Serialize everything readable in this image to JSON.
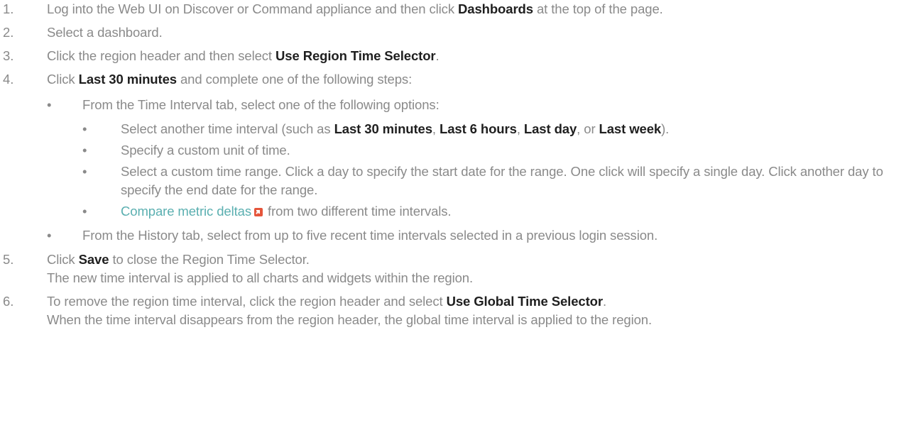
{
  "steps": [
    {
      "num": "1.",
      "parts": [
        {
          "t": "Log into the Web UI on Discover or Command appliance and then click "
        },
        {
          "t": "Dashboards",
          "b": true
        },
        {
          "t": " at the top of the page."
        }
      ]
    },
    {
      "num": "2.",
      "parts": [
        {
          "t": "Select a dashboard."
        }
      ]
    },
    {
      "num": "3.",
      "parts": [
        {
          "t": "Click the region header and then select "
        },
        {
          "t": "Use Region Time Selector",
          "b": true
        },
        {
          "t": "."
        }
      ]
    },
    {
      "num": "4.",
      "parts": [
        {
          "t": "Click "
        },
        {
          "t": "Last 30 minutes",
          "b": true
        },
        {
          "t": " and complete one of the following steps:"
        }
      ],
      "bullets": [
        {
          "parts": [
            {
              "t": "From the Time Interval tab, select one of the following options:"
            }
          ],
          "sub": [
            {
              "parts": [
                {
                  "t": "Select another time interval (such as "
                },
                {
                  "t": "Last 30 minutes",
                  "b": true
                },
                {
                  "t": ", "
                },
                {
                  "t": "Last 6 hours",
                  "b": true
                },
                {
                  "t": ", "
                },
                {
                  "t": "Last day",
                  "b": true
                },
                {
                  "t": ", or "
                },
                {
                  "t": "Last week",
                  "b": true
                },
                {
                  "t": ")."
                }
              ]
            },
            {
              "parts": [
                {
                  "t": "Specify a custom unit of time."
                }
              ]
            },
            {
              "parts": [
                {
                  "t": "Select a custom time range. Click a day to specify the start date for the range. One click will specify a single day. Click another day to specify the end date for the range."
                }
              ]
            },
            {
              "parts": [
                {
                  "t": "Compare metric deltas",
                  "link": true
                },
                {
                  "icon": "external-link-icon"
                },
                {
                  "t": " from two different time intervals."
                }
              ]
            }
          ]
        },
        {
          "parts": [
            {
              "t": "From the History tab, select from up to five recent time intervals selected in a previous login session."
            }
          ]
        }
      ]
    },
    {
      "num": "5.",
      "parts": [
        {
          "t": "Click "
        },
        {
          "t": "Save",
          "b": true
        },
        {
          "t": " to close the Region Time Selector."
        }
      ],
      "after": "The new time interval is applied to all charts and widgets within the region."
    },
    {
      "num": "6.",
      "parts": [
        {
          "t": "To remove the region time interval, click the region header and select "
        },
        {
          "t": "Use Global Time Selector",
          "b": true
        },
        {
          "t": "."
        }
      ],
      "after": "When the time interval disappears from the region header, the global time interval is applied to the region."
    }
  ],
  "bullet_glyph": "•",
  "colors": {
    "text": "#8a8a8a",
    "bold": "#1f1f1f",
    "link": "#5aafb0",
    "icon": "#e5553b"
  }
}
